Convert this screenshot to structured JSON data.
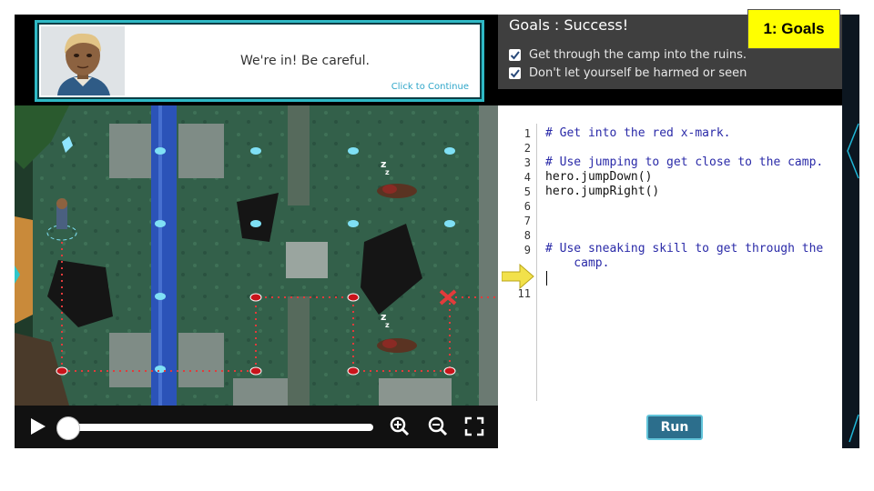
{
  "dialog": {
    "message": "We're in! Be careful.",
    "continue_label": "Click to Continue"
  },
  "goals": {
    "title": "Goals : Success!",
    "items": [
      {
        "label": "Get through the camp into the ruins.",
        "checked": true
      },
      {
        "label": "Don't let yourself be harmed or seen",
        "checked": true
      }
    ],
    "badge": "1: Goals"
  },
  "game": {
    "sleep_marks": [
      "z",
      "z",
      "z",
      "z"
    ]
  },
  "editor": {
    "line_numbers": [
      "1",
      "2",
      "3",
      "4",
      "5",
      "6",
      "7",
      "8",
      "9",
      "",
      "11"
    ],
    "lines": [
      "# Get into the red x-mark.",
      "",
      "# Use jumping to get close to the camp.",
      "hero.jumpDown()",
      "hero.jumpRight()",
      "",
      "",
      "",
      "# Use sneaking skill to get through the",
      "    camp.",
      ""
    ],
    "run_label": "Run"
  },
  "colors": {
    "accent": "#2fb9c5",
    "badge": "#ffff00",
    "path": "#e23b3b"
  }
}
